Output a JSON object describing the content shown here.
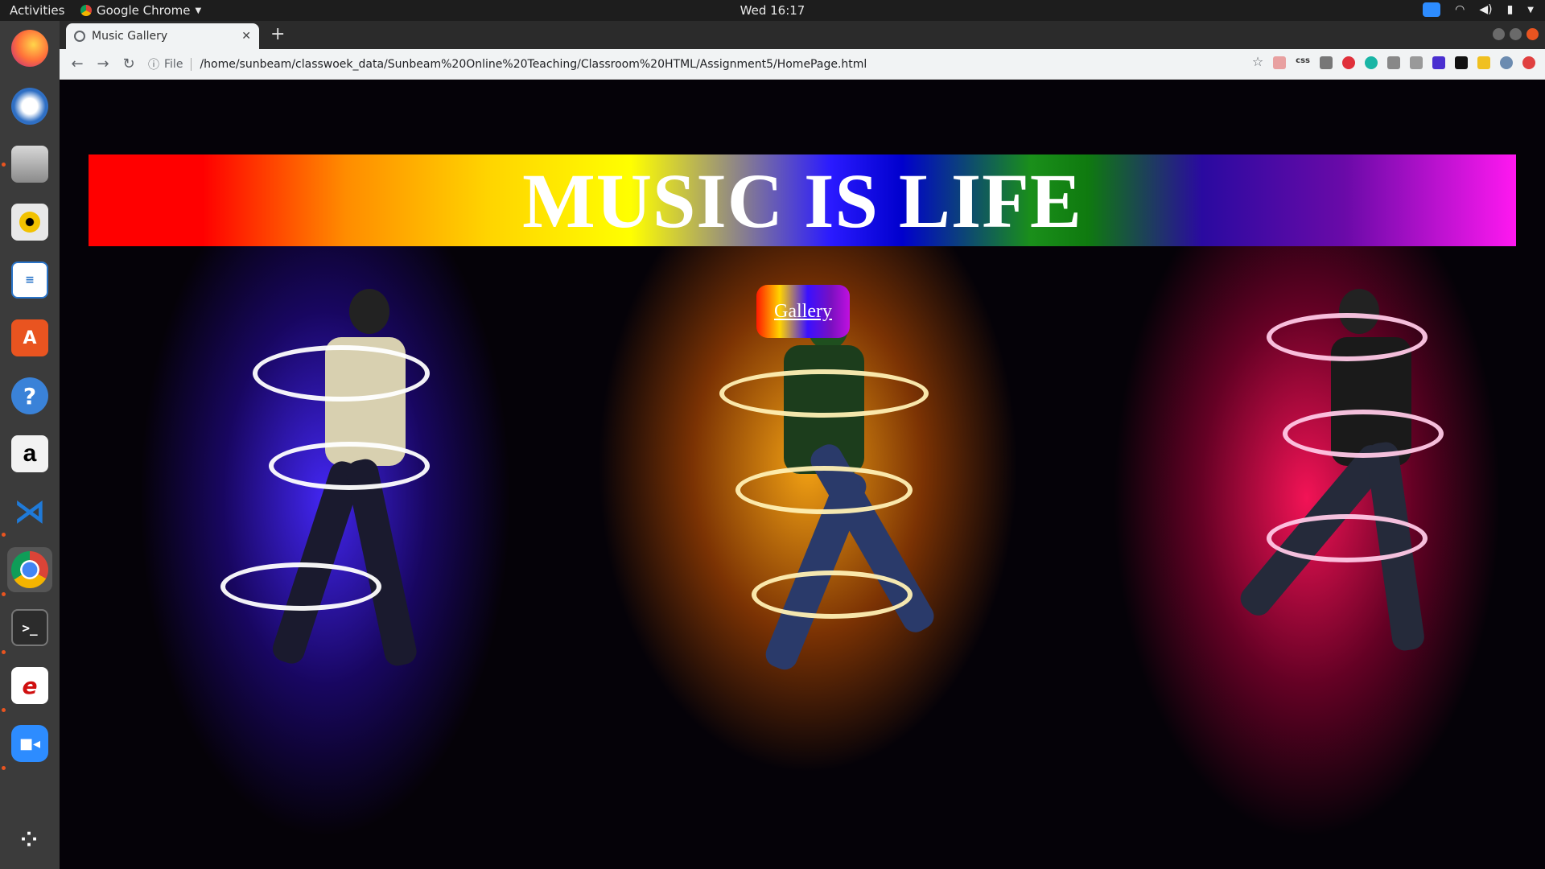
{
  "topbar": {
    "activities": "Activities",
    "app_name": "Google Chrome",
    "clock": "Wed 16:17"
  },
  "dock": {
    "items": [
      {
        "name": "firefox-icon",
        "color": "#ff7139"
      },
      {
        "name": "thunderbird-icon",
        "color": "#2f6fc4"
      },
      {
        "name": "files-icon",
        "color": "#8a8a8a"
      },
      {
        "name": "rhythmbox-icon",
        "color": "#f2c200"
      },
      {
        "name": "libreoffice-writer-icon",
        "color": "#2a74c8"
      },
      {
        "name": "software-center-icon",
        "color": "#e95420"
      },
      {
        "name": "help-icon",
        "color": "#3a82d8"
      },
      {
        "name": "amazon-icon",
        "color": "#f2f2f2"
      },
      {
        "name": "vscode-icon",
        "color": "#1f7ad8"
      },
      {
        "name": "chrome-icon",
        "color": "#db4437"
      },
      {
        "name": "terminal-icon",
        "color": "#2c2c2c"
      },
      {
        "name": "eclipse-icon",
        "color": "#ffffff"
      },
      {
        "name": "zoom-icon",
        "color": "#2d8cff"
      },
      {
        "name": "show-apps-icon",
        "color": "#3b3b3b"
      }
    ]
  },
  "browser": {
    "tab_title": "Music Gallery",
    "new_tab": "+",
    "address_prefix": "File",
    "address": "/home/sunbeam/classwoek_data/Sunbeam%20Online%20Teaching/Classroom%20HTML/Assignment5/HomePage.html"
  },
  "page": {
    "banner_title": "MUSIC IS LIFE",
    "gallery_link": "Gallery"
  }
}
